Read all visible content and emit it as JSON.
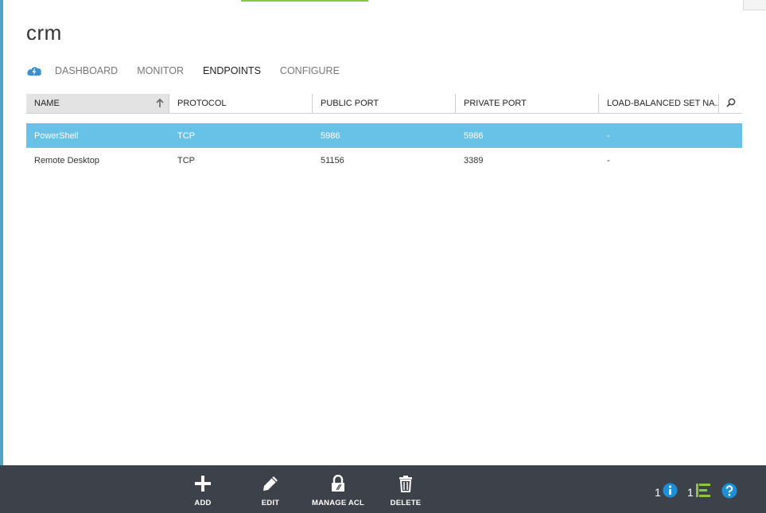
{
  "page": {
    "title": "crm"
  },
  "tabs": [
    {
      "label": "DASHBOARD",
      "active": false
    },
    {
      "label": "MONITOR",
      "active": false
    },
    {
      "label": "ENDPOINTS",
      "active": true
    },
    {
      "label": "CONFIGURE",
      "active": false
    }
  ],
  "grid": {
    "columns": [
      "NAME",
      "PROTOCOL",
      "PUBLIC PORT",
      "PRIVATE PORT",
      "LOAD-BALANCED SET NA..."
    ],
    "sorted_column": "NAME",
    "sort_direction": "ascending",
    "rows": [
      {
        "name": "PowerShell",
        "protocol": "TCP",
        "public_port": "5986",
        "private_port": "5986",
        "lb_set": "-",
        "selected": true
      },
      {
        "name": "Remote Desktop",
        "protocol": "TCP",
        "public_port": "51156",
        "private_port": "3389",
        "lb_set": "-",
        "selected": false
      }
    ]
  },
  "commands": [
    {
      "label": "ADD",
      "icon": "plus-icon"
    },
    {
      "label": "EDIT",
      "icon": "pencil-icon"
    },
    {
      "label": "MANAGE ACL",
      "icon": "lock-icon"
    },
    {
      "label": "DELETE",
      "icon": "trash-icon"
    }
  ],
  "status": {
    "info_count": "1",
    "operations_count": "1"
  },
  "colors": {
    "accent_blue": "#4fa3c7",
    "selected_row": "#68c2e8",
    "command_bar": "#3c414a",
    "progress_green": "#8cc63f",
    "info_blue": "#1e8fd6",
    "ops_green": "#8cc63f"
  }
}
